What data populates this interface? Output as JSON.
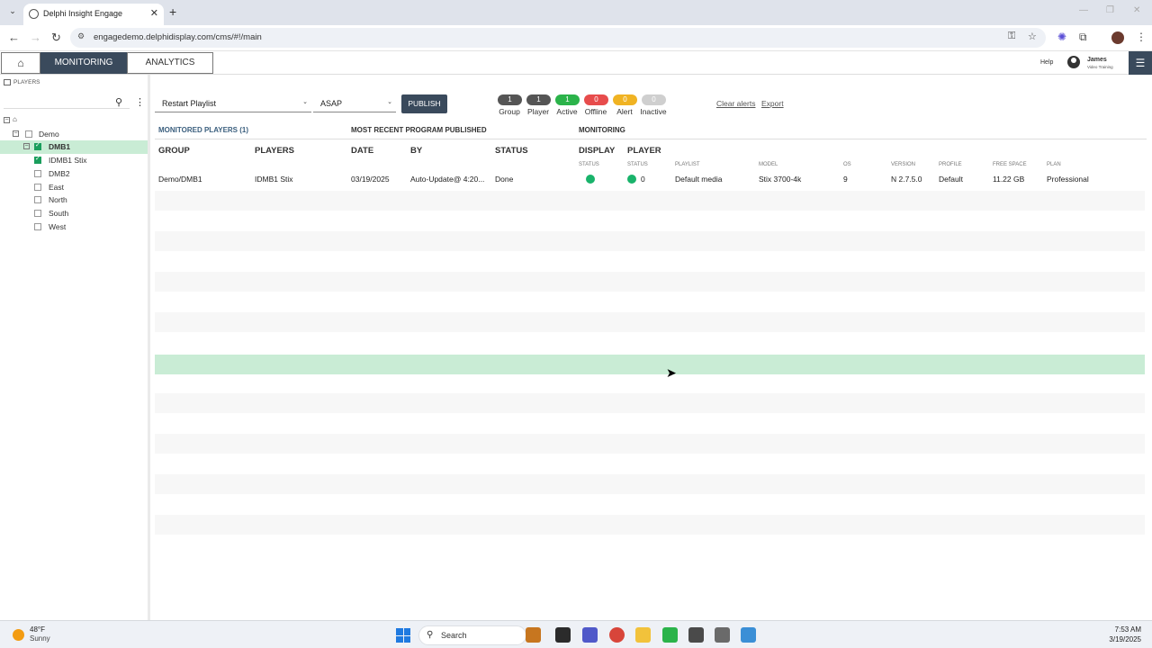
{
  "browser": {
    "tab_title": "Delphi Insight Engage",
    "url": "engagedemo.delphidisplay.com/cms/#!/main"
  },
  "header": {
    "tabs": [
      "MONITORING",
      "ANALYTICS"
    ],
    "help": "Help",
    "user_name": "James",
    "user_role": "Video Training"
  },
  "sidebar": {
    "title": "PLAYERS",
    "tree": [
      {
        "label": "Demo",
        "checked": false
      },
      {
        "label": "DMB1",
        "checked": true,
        "selected": true
      },
      {
        "label": "IDMB1 Stix",
        "checked": true
      },
      {
        "label": "DMB2",
        "checked": false
      },
      {
        "label": "East",
        "checked": false
      },
      {
        "label": "North",
        "checked": false
      },
      {
        "label": "South",
        "checked": false
      },
      {
        "label": "West",
        "checked": false
      }
    ]
  },
  "toolbar": {
    "action": "Restart Playlist",
    "timing": "ASAP",
    "publish": "PUBLISH",
    "clear_alerts": "Clear alerts",
    "export": "Export"
  },
  "counters": [
    {
      "count": "1",
      "label": "Group",
      "color": "#555555"
    },
    {
      "count": "1",
      "label": "Player",
      "color": "#555555"
    },
    {
      "count": "1",
      "label": "Active",
      "color": "#2bb34a"
    },
    {
      "count": "0",
      "label": "Offline",
      "color": "#e74c4c"
    },
    {
      "count": "0",
      "label": "Alert",
      "color": "#f0b323"
    },
    {
      "count": "0",
      "label": "Inactive",
      "color": "#cfcfcf"
    }
  ],
  "table": {
    "monitored": "MONITORED PLAYERS (1)",
    "recent": "MOST RECENT PROGRAM PUBLISHED",
    "monitoring": "MONITORING",
    "columns": [
      "GROUP",
      "PLAYERS",
      "DATE",
      "BY",
      "STATUS",
      "DISPLAY",
      "PLAYER"
    ],
    "subcolumns": [
      "STATUS",
      "STATUS",
      "PLAYLIST",
      "MODEL",
      "OS",
      "VERSION",
      "PROFILE",
      "FREE SPACE",
      "PLAN"
    ],
    "row": {
      "group": "Demo/DMB1",
      "player": "IDMB1 Stix",
      "date": "03/19/2025",
      "by": "Auto-Update@ 4:20...",
      "status": "Done",
      "player_count": "0",
      "playlist": "Default media",
      "model": "Stix 3700-4k",
      "os": "9",
      "version": "N 2.7.5.0",
      "profile": "Default",
      "free_space": "11.22 GB",
      "plan": "Professional"
    }
  },
  "taskbar": {
    "temp": "48°F",
    "condition": "Sunny",
    "search": "Search",
    "time": "7:53 AM",
    "date": "3/19/2025"
  }
}
